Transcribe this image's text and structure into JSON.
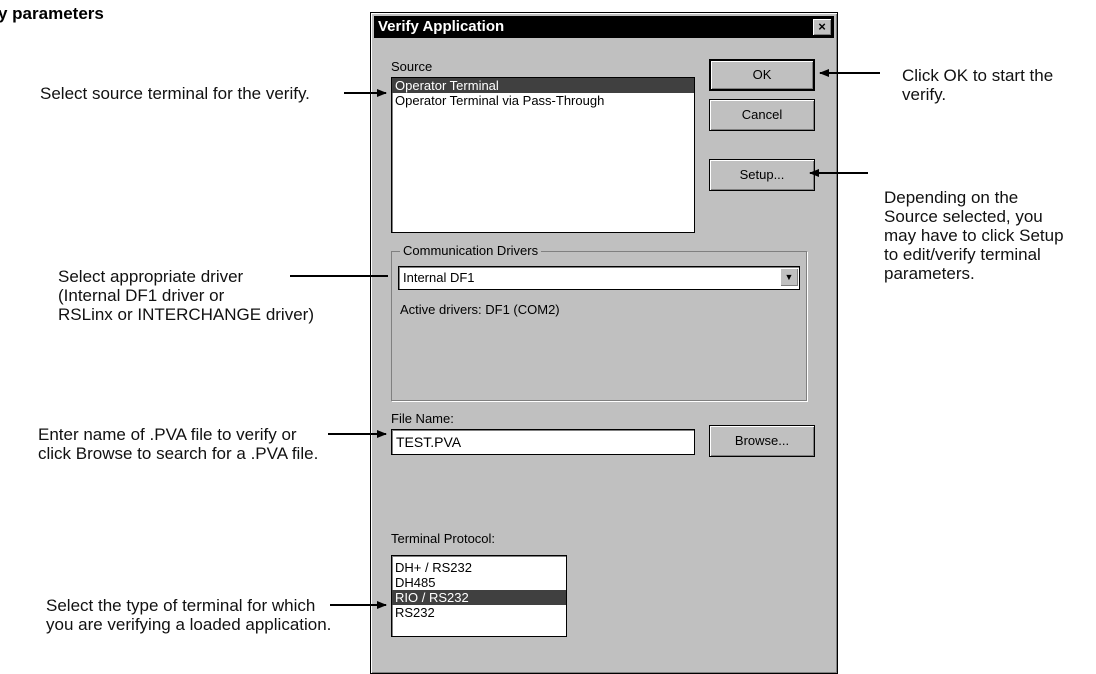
{
  "page_heading": "y parameters",
  "dialog": {
    "title": "Verify Application",
    "close_label": "×",
    "source": {
      "label": "Source",
      "items": [
        "Operator Terminal",
        "Operator Terminal via Pass-Through"
      ],
      "selected_index": 0
    },
    "buttons": {
      "ok": "OK",
      "cancel": "Cancel",
      "setup": "Setup...",
      "browse": "Browse..."
    },
    "drivers": {
      "label": "Communication Drivers",
      "selected": "Internal DF1",
      "active": "Active drivers: DF1 (COM2)"
    },
    "file": {
      "label": "File Name:",
      "value": "TEST.PVA"
    },
    "protocol": {
      "label": "Terminal Protocol:",
      "items": [
        "DH+ / RS232",
        "DH485",
        "RIO / RS232",
        "RS232"
      ],
      "selected_index": 2
    }
  },
  "callouts": {
    "source": "Select source terminal for the verify.",
    "driver_1": "Select appropriate driver",
    "driver_2": "(Internal DF1 driver or",
    "driver_3": "RSLinx or INTERCHANGE driver)",
    "file_1": "Enter name of .PVA file to verify or",
    "file_2": "click Browse to search for a .PVA file.",
    "type_1": "Select the type of terminal for which",
    "type_2": "you are verifying a loaded application.",
    "ok_1": "Click OK to start the",
    "ok_2": "verify.",
    "setup_1": "Depending on the",
    "setup_2": "Source selected, you",
    "setup_3": "may have to click Setup",
    "setup_4": "to edit/verify terminal",
    "setup_5": "parameters."
  }
}
